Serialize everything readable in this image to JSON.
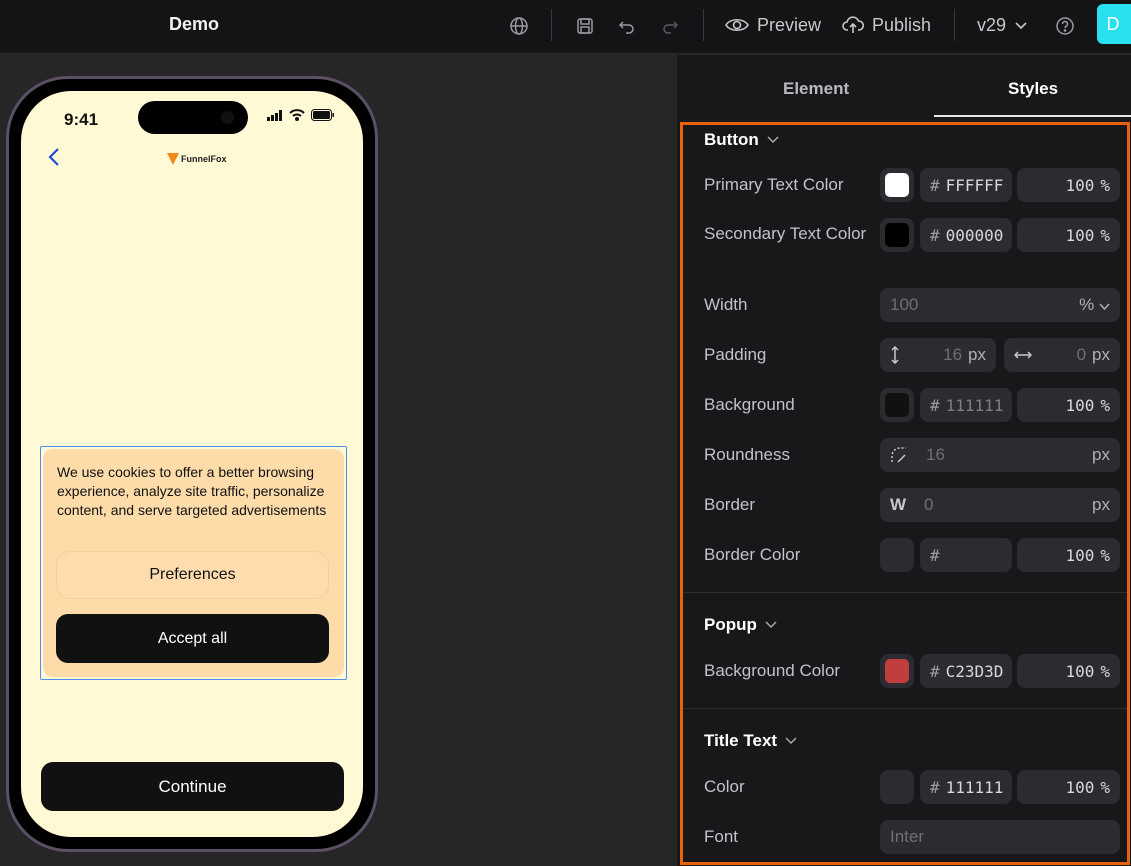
{
  "app": {
    "title": "Demo",
    "version": "v29",
    "avatar_letter": "D"
  },
  "toolbar": {
    "preview_label": "Preview",
    "publish_label": "Publish"
  },
  "phone": {
    "time": "9:41",
    "brand": "FunnelFox",
    "popup_text": "We use cookies to offer a better browsing experience, analyze site traffic, personalize content, and serve targeted advertisements",
    "preferences_label": "Preferences",
    "accept_label": "Accept all",
    "continue_label": "Continue"
  },
  "panel": {
    "tabs": [
      "Element",
      "Styles"
    ],
    "active_tab": "Styles",
    "button_section": {
      "title": "Button",
      "primary_text_color": {
        "label": "Primary Text Color",
        "hex": "FFFFFF",
        "opacity": "100",
        "color": "#FFFFFF"
      },
      "secondary_text_color": {
        "label": "Secondary Text Color",
        "hex": "000000",
        "opacity": "100",
        "color": "#000000"
      },
      "width": {
        "label": "Width",
        "placeholder": "100",
        "unit": "%"
      },
      "padding": {
        "label": "Padding",
        "vertical": "16",
        "horizontal": "0",
        "unit": "px"
      },
      "background": {
        "label": "Background",
        "hex": "111111",
        "opacity": "100",
        "color": "#111111"
      },
      "roundness": {
        "label": "Roundness",
        "placeholder": "16",
        "unit": "px"
      },
      "border": {
        "label": "Border",
        "prefix": "W",
        "placeholder": "0",
        "unit": "px"
      },
      "border_color": {
        "label": "Border Color",
        "hex": "",
        "opacity": "100"
      }
    },
    "popup_section": {
      "title": "Popup",
      "background_color": {
        "label": "Background Color",
        "hex": "C23D3D",
        "opacity": "100",
        "color": "#C23D3D"
      }
    },
    "title_text_section": {
      "title": "Title Text",
      "color": {
        "label": "Color",
        "hex": "111111",
        "opacity": "100"
      },
      "font": {
        "label": "Font",
        "placeholder": "Inter"
      }
    },
    "percent_symbol": "%",
    "hash_symbol": "#"
  }
}
